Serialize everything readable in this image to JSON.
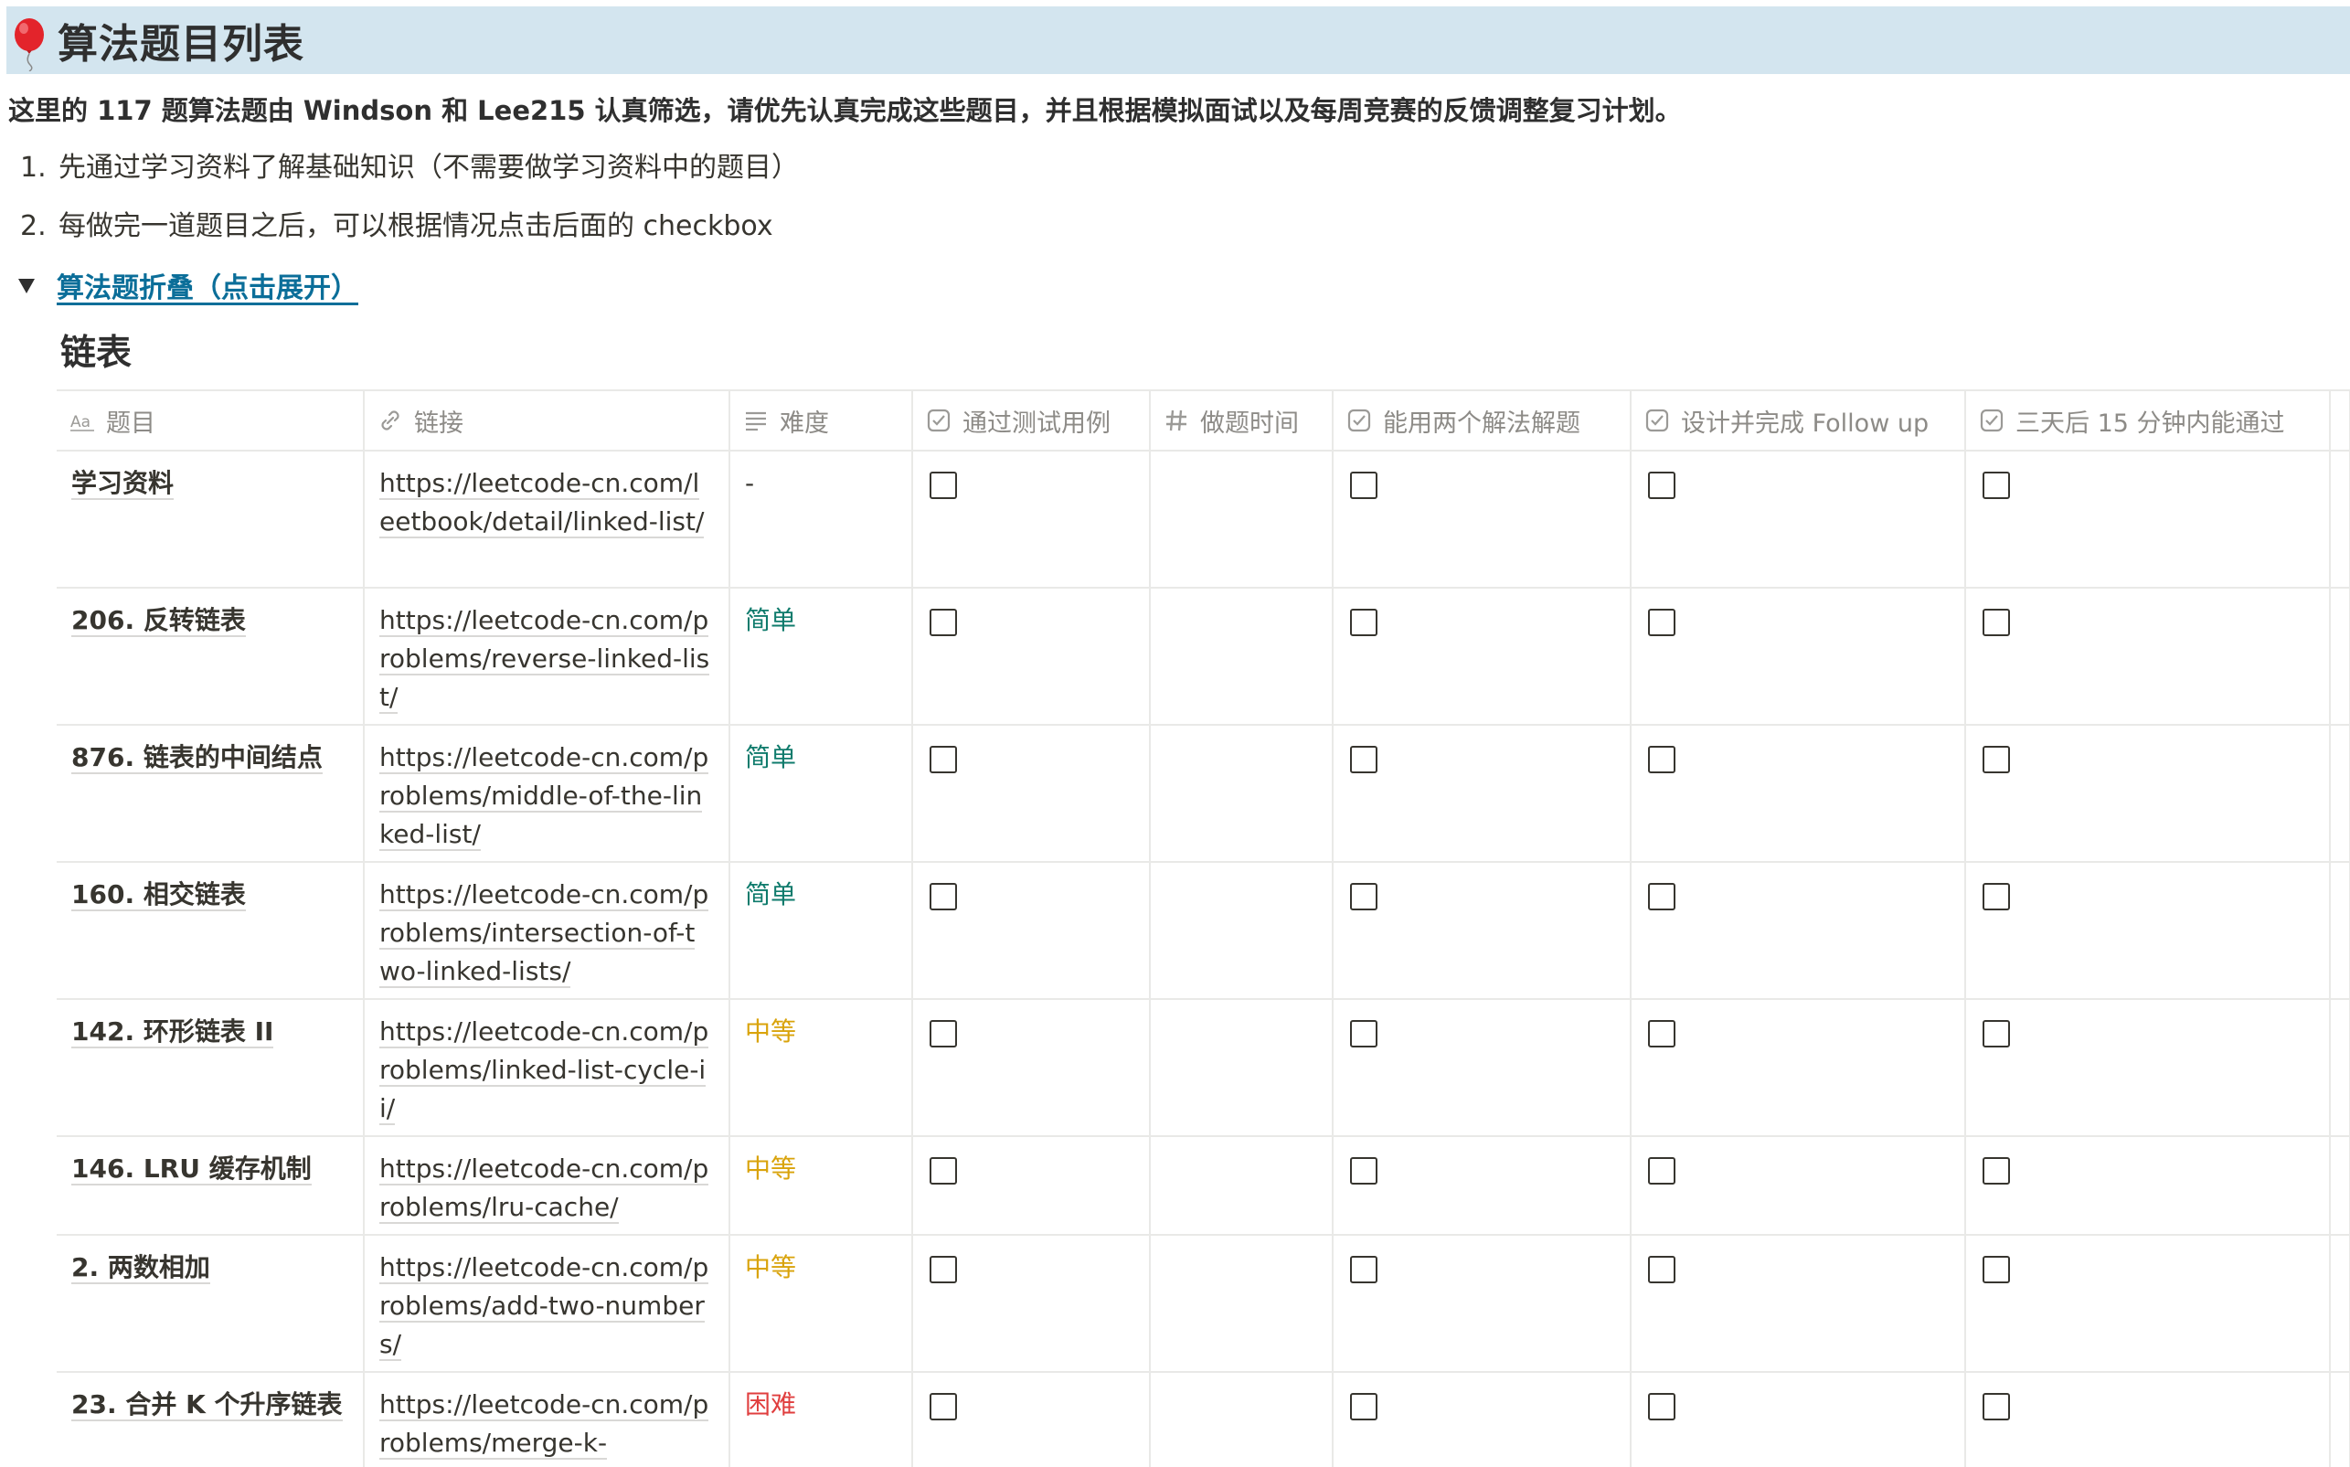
{
  "page": {
    "title": "算法题目列表",
    "intro": "这里的 117 题算法题由 Windson 和 Lee215 认真筛选，请优先认真完成这些题目，并且根据模拟面试以及每周竞赛的反馈调整复习计划。",
    "list": [
      {
        "num": "1.",
        "text": "先通过学习资料了解基础知识（不需要做学习资料中的题目）"
      },
      {
        "num": "2.",
        "text": "每做完一道题目之后，可以根据情况点击后面的 checkbox"
      }
    ],
    "toggle_label": "算法题折叠（点击展开）",
    "section_heading": "链表"
  },
  "table": {
    "columns": [
      {
        "label": "题目",
        "icon": "title-aa-icon"
      },
      {
        "label": "链接",
        "icon": "link-icon"
      },
      {
        "label": "难度",
        "icon": "text-lines-icon"
      },
      {
        "label": "通过测试用例",
        "icon": "checkbox-property-icon"
      },
      {
        "label": "做题时间",
        "icon": "hash-icon"
      },
      {
        "label": "能用两个解法解题",
        "icon": "checkbox-property-icon"
      },
      {
        "label": "设计并完成 Follow up",
        "icon": "checkbox-property-icon"
      },
      {
        "label": "三天后 15 分钟内能通过",
        "icon": "checkbox-property-icon"
      }
    ],
    "rows": [
      {
        "name": "学习资料",
        "link": "https://leetcode-cn.com/leetbook/detail/linked-list/",
        "difficulty": "-",
        "difficulty_color": "#37352f"
      },
      {
        "name": "206. 反转链表",
        "link": "https://leetcode-cn.com/problems/reverse-linked-list/",
        "difficulty": "简单",
        "difficulty_color": "#0f7b6c"
      },
      {
        "name": "876. 链表的中间结点",
        "link": "https://leetcode-cn.com/problems/middle-of-the-linked-list/",
        "difficulty": "简单",
        "difficulty_color": "#0f7b6c"
      },
      {
        "name": "160. 相交链表",
        "link": "https://leetcode-cn.com/problems/intersection-of-two-linked-lists/",
        "difficulty": "简单",
        "difficulty_color": "#0f7b6c"
      },
      {
        "name": "142. 环形链表 II",
        "link": "https://leetcode-cn.com/problems/linked-list-cycle-ii/",
        "difficulty": "中等",
        "difficulty_color": "#d9a30b"
      },
      {
        "name": "146. LRU 缓存机制",
        "link": "https://leetcode-cn.com/problems/lru-cache/",
        "difficulty": "中等",
        "difficulty_color": "#d9a30b"
      },
      {
        "name": "2. 两数相加",
        "link": "https://leetcode-cn.com/problems/add-two-numbers/",
        "difficulty": "中等",
        "difficulty_color": "#d9a30b"
      },
      {
        "name": "23. 合并 K 个升序链表",
        "link": "https://leetcode-cn.com/problems/merge-k-",
        "difficulty": "困难",
        "difficulty_color": "#e03e3e"
      }
    ]
  },
  "colors": {
    "title_bg": "#d3e5ef",
    "link_blue": "#0b6e99",
    "easy": "#0f7b6c",
    "medium": "#d9a30b",
    "hard": "#e03e3e"
  }
}
